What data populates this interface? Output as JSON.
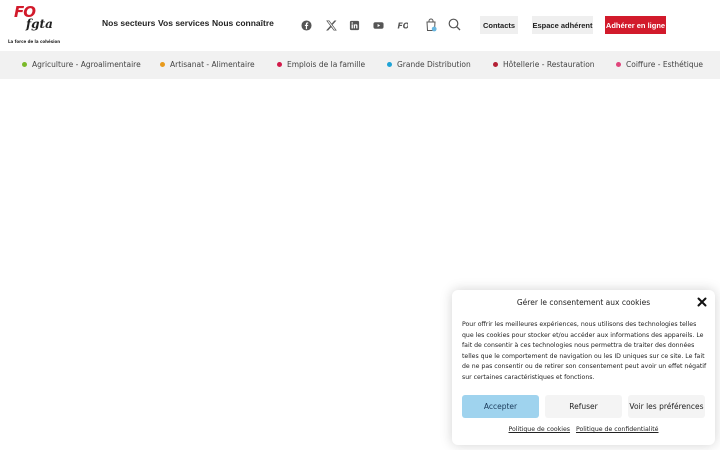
{
  "brand": {
    "logo_text_1": "FO",
    "logo_text_2": "fgta",
    "tagline": "La force de la cohésion",
    "red": "#d21a2b"
  },
  "nav": {
    "items": [
      "Nos secteurs",
      "Vos services",
      "Nous connaître"
    ]
  },
  "social_icons": [
    "facebook-icon",
    "x-twitter-icon",
    "linkedin-icon",
    "youtube-icon",
    "fo-icon",
    "cart-icon",
    "search-icon"
  ],
  "buttons": {
    "contacts": "Contacts",
    "espace": "Espace adhérent",
    "adherer": "Adhérer en ligne"
  },
  "sectors": [
    {
      "label": "Agriculture - Agroalimentaire",
      "color": "#7ab929"
    },
    {
      "label": "Artisanat - Alimentaire",
      "color": "#e89a1c"
    },
    {
      "label": "Emplois de la famille",
      "color": "#d21a4a"
    },
    {
      "label": "Grande Distribution",
      "color": "#1fa3d6"
    },
    {
      "label": "Hôtellerie - Restauration",
      "color": "#b42035"
    },
    {
      "label": "Coiffure - Esthétique",
      "color": "#e0457b"
    }
  ],
  "consent": {
    "title": "Gérer le consentement aux cookies",
    "text": "Pour offrir les meilleures expériences, nous utilisons des technologies telles que les cookies pour stocker et/ou accéder aux informations des appareils. Le fait de consentir à ces technologies nous permettra de traiter des données telles que le comportement de navigation ou les ID uniques sur ce site. Le fait de ne pas consentir ou de retirer son consentement peut avoir un effet négatif sur certaines caractéristiques et fonctions.",
    "accept": "Accepter",
    "refuse": "Refuser",
    "prefs": "Voir les préférences",
    "link_cookies": "Politique de cookies",
    "link_privacy": "Politique de confidentialité",
    "accept_color": "#9fd3ee"
  }
}
